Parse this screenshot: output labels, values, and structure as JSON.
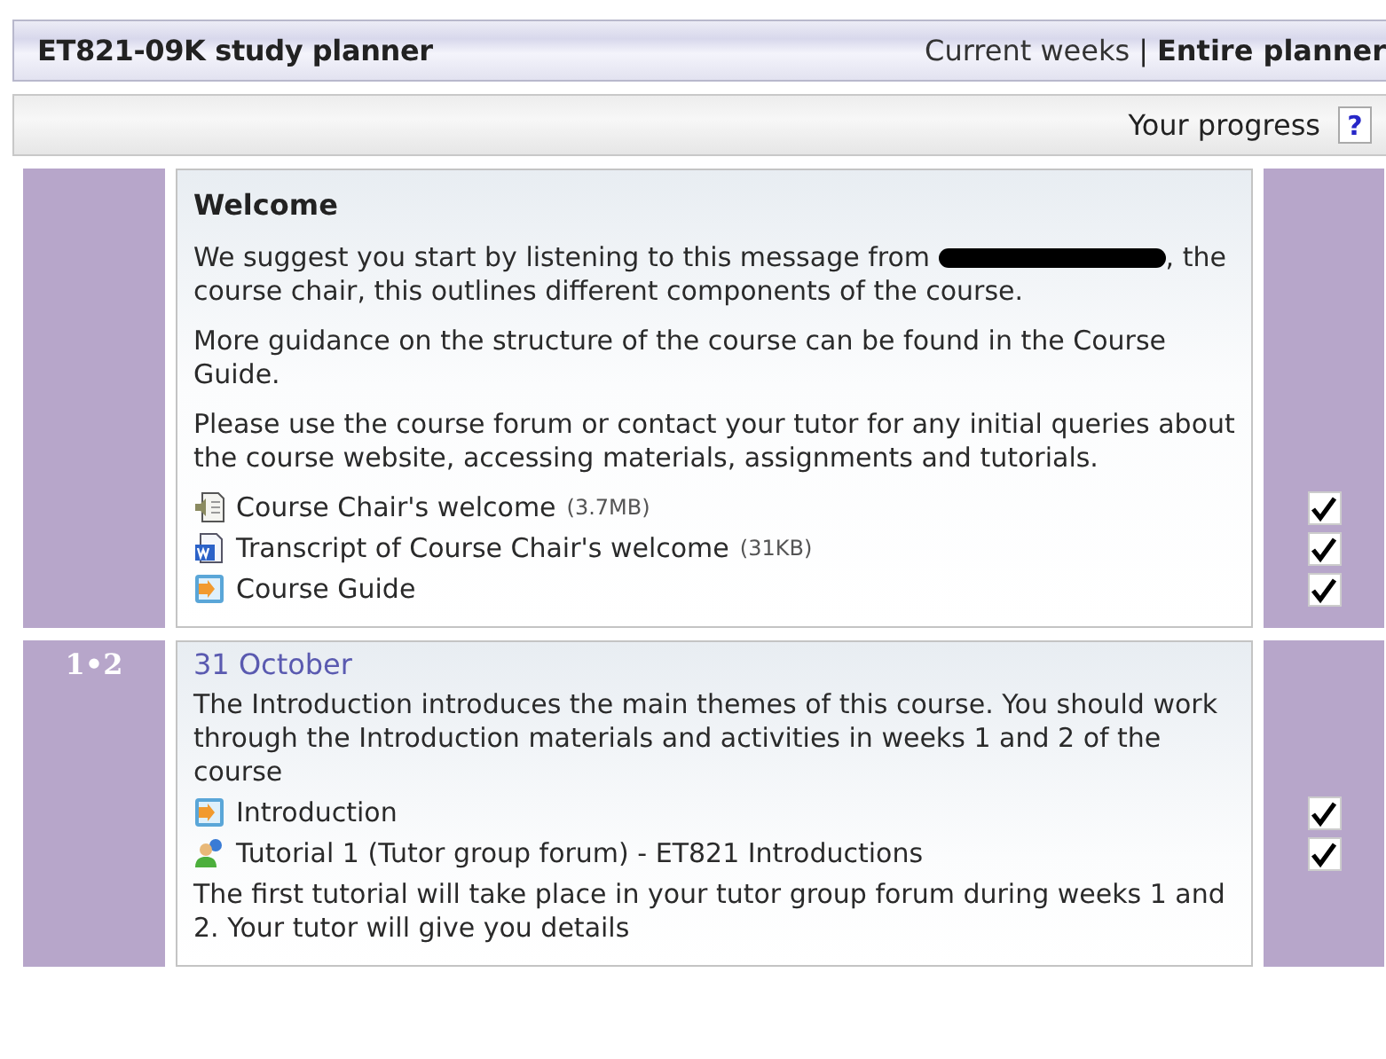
{
  "header": {
    "title": "ET821-09K study planner",
    "views": [
      {
        "label": "Current weeks",
        "selected": false
      },
      {
        "label": "Entire planner",
        "selected": true
      }
    ],
    "separator": "|"
  },
  "toolbar": {
    "label": "Your progress",
    "help": "?"
  },
  "sections": [
    {
      "kind": "intro",
      "title": "Welcome",
      "items": [
        {
          "kind": "text",
          "text": "We suggest you start by listening to this message from",
          "redacted": true,
          "after": ", the course chair, this outlines different components of the course."
        },
        {
          "kind": "text",
          "text": "More guidance on the structure of the course can be found in the Course Guide."
        },
        {
          "kind": "text",
          "text": "Please use the course forum or contact your tutor for any initial queries about the course website, accessing materials, assignments and tutorials."
        },
        {
          "kind": "audio",
          "label": "Course Chair's welcome",
          "size": "(3.7MB)",
          "checked": true
        },
        {
          "kind": "document",
          "label": "Transcript of Course Chair's welcome",
          "size": "(31KB)",
          "checked": true
        },
        {
          "kind": "guide",
          "label": "Course Guide",
          "checked": true
        }
      ]
    },
    {
      "kind": "week",
      "week": "1•2",
      "title": "31 October",
      "items": [
        {
          "kind": "text",
          "text": "The Introduction introduces the main themes of this course. You should work through the Introduction materials and activities in weeks 1 and 2 of the course"
        },
        {
          "kind": "guide",
          "label": "Introduction",
          "checked": true
        },
        {
          "kind": "forum",
          "label": "Tutorial 1 (Tutor group forum) - ET821 Introductions",
          "checked": true
        },
        {
          "kind": "text",
          "text": "The first tutorial will take place in your tutor group forum during weeks 1 and 2. Your tutor will give you details"
        }
      ]
    }
  ]
}
